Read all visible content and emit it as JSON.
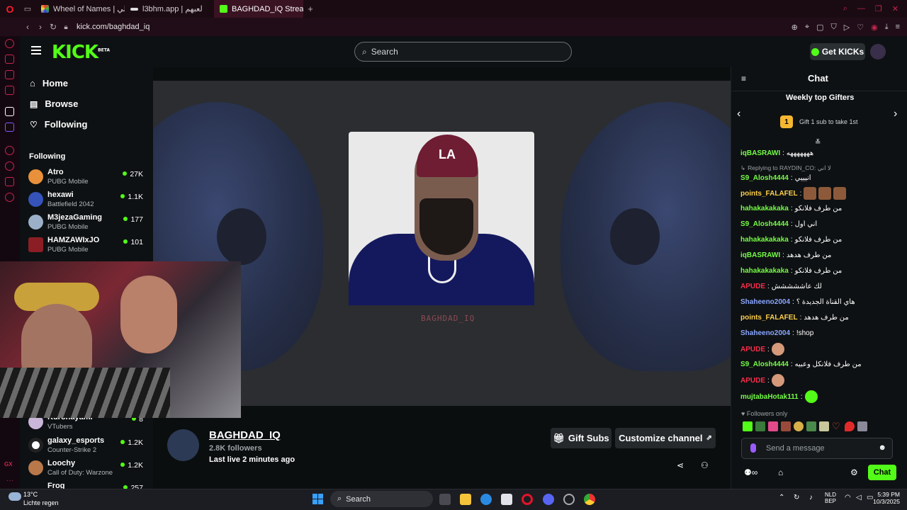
{
  "browser": {
    "tabs": [
      {
        "label": "Wheel of Names | طشوالي",
        "active": false
      },
      {
        "label": "l3bhm.app | لعبهم",
        "active": false
      },
      {
        "label": "BAGHDAD_IQ Stream - W",
        "active": true
      }
    ],
    "url": "kick.com/baghdad_iq"
  },
  "header": {
    "logo": "KICK",
    "logo_badge": "BETA",
    "search_placeholder": "Search",
    "get_kicks": "Get KICKs"
  },
  "sidebar": {
    "nav": [
      {
        "label": "Home",
        "icon": "home-icon"
      },
      {
        "label": "Browse",
        "icon": "browse-icon"
      },
      {
        "label": "Following",
        "icon": "heart-icon"
      }
    ],
    "following_title": "Following",
    "following": [
      {
        "name": "Atro",
        "game": "PUBG Mobile",
        "viewers": "27K"
      },
      {
        "name": "hexawi",
        "game": "Battlefield 2042",
        "viewers": "1.1K"
      },
      {
        "name": "M3jezaGaming",
        "game": "PUBG Mobile",
        "viewers": "177"
      },
      {
        "name": "HAMZAWIxJO",
        "game": "PUBG Mobile",
        "viewers": "101"
      },
      {
        "name": "Kuronayami",
        "game": "VTubers",
        "viewers": "8"
      },
      {
        "name": "galaxy_esports",
        "game": "Counter-Strike 2",
        "viewers": "1.2K"
      },
      {
        "name": "Loochy",
        "game": "Call of Duty: Warzone",
        "viewers": "1.2K"
      },
      {
        "name": "Frog",
        "game": "",
        "viewers": "257"
      }
    ]
  },
  "player": {
    "brand_text": "BAGHDAD_IQ",
    "cap_text": "LA"
  },
  "channel": {
    "name": "BAGHDAD_IQ",
    "followers": "2.8K followers",
    "last_live": "Last live 2 minutes ago",
    "gift_subs": "Gift Subs",
    "customize": "Customize channel"
  },
  "chat": {
    "title": "Chat",
    "weekly_title": "Weekly top Gifters",
    "gifter_rank": "1",
    "gifter_text": "Gift 1 sub to take 1st",
    "reply_note": "Replying to RAYDIN_CO: لا اني",
    "messages": [
      {
        "user": "iqBASRAWI",
        "color": "#75fd46",
        "text": "هههههههه"
      },
      {
        "user": "S9_Alosh4444",
        "color": "#75fd46",
        "text": "انيييي"
      },
      {
        "user": "points_FALAFEL",
        "color": "#fbcf4c",
        "text": ""
      },
      {
        "user": "hahakakakaka",
        "color": "#75fd46",
        "text": "من طرف فلانكو"
      },
      {
        "user": "S9_Alosh4444",
        "color": "#75fd46",
        "text": "اني اول"
      },
      {
        "user": "hahakakakaka",
        "color": "#75fd46",
        "text": "من طرف فلانكو"
      },
      {
        "user": "iqBASRAWI",
        "color": "#75fd46",
        "text": "من طرف هدهد"
      },
      {
        "user": "hahakakakaka",
        "color": "#75fd46",
        "text": "من طرف فلانكو"
      },
      {
        "user": "APUDE",
        "color": "#fb2c4a",
        "text": "لك عاششششش"
      },
      {
        "user": "Shaheeno2004",
        "color": "#8aa6ff",
        "text": "هاي القناة الجديدة ؟"
      },
      {
        "user": "points_FALAFEL",
        "color": "#fbcf4c",
        "text": "من طرف هدهد"
      },
      {
        "user": "Shaheeno2004",
        "color": "#8aa6ff",
        "text": "!shop"
      },
      {
        "user": "APUDE",
        "color": "#fb2c4a",
        "text": ""
      },
      {
        "user": "S9_Alosh4444",
        "color": "#75fd46",
        "text": "من طرف فلانكل وعبيه"
      },
      {
        "user": "APUDE",
        "color": "#fb2c4a",
        "text": ""
      },
      {
        "user": "mujtabaHotak111",
        "color": "#75fd46",
        "text": ""
      }
    ],
    "followers_only": "Followers only",
    "send_placeholder": "Send a message",
    "chat_button": "Chat"
  },
  "taskbar": {
    "weather_temp": "13°C",
    "weather_desc": "Lichte regen",
    "search": "Search",
    "lang": "NLD",
    "lang_sub": "BEP",
    "time": "5:39 PM",
    "date": "10/3/2025"
  }
}
